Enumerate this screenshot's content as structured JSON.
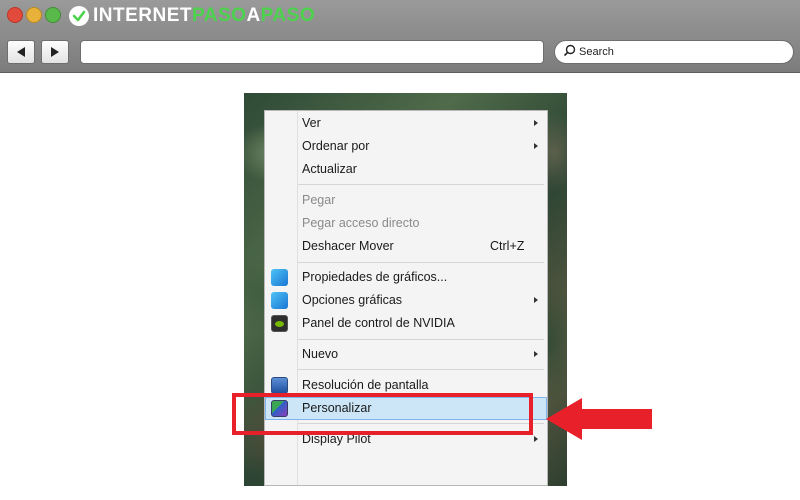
{
  "brand": {
    "part1": "INTERNET",
    "part2": "PASO",
    "part3": "A",
    "part4": "PASO"
  },
  "search": {
    "placeholder": "Search"
  },
  "menu": {
    "items": [
      {
        "label": "Ver",
        "submenu": true
      },
      {
        "label": "Ordenar por",
        "submenu": true
      },
      {
        "label": "Actualizar"
      },
      {
        "label": "Pegar",
        "disabled": true
      },
      {
        "label": "Pegar acceso directo",
        "disabled": true
      },
      {
        "label": "Deshacer Mover",
        "shortcut": "Ctrl+Z"
      },
      {
        "label": "Propiedades de gráficos...",
        "icon": "intel-graphics-icon"
      },
      {
        "label": "Opciones gráficas",
        "icon": "intel-graphics-icon",
        "submenu": true
      },
      {
        "label": "Panel de control de NVIDIA",
        "icon": "nvidia-icon"
      },
      {
        "label": "Nuevo",
        "submenu": true
      },
      {
        "label": "Resolución de pantalla",
        "icon": "monitor-icon"
      },
      {
        "label": "Personalizar",
        "icon": "personalize-icon",
        "highlighted": true
      },
      {
        "label": "Display Pilot",
        "submenu": true
      }
    ]
  },
  "colors": {
    "highlight_box": "#e8202a",
    "menu_hover": "#cde6f7",
    "brand_green": "#4cd34c"
  }
}
